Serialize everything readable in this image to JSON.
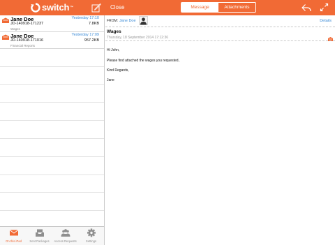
{
  "app": {
    "logo_text": "switch",
    "logo_tm": "™",
    "brand_color": "#f16a35",
    "link_color": "#3a8ad6"
  },
  "toolbar": {
    "compose_icon": "compose-icon",
    "close_label": "Close",
    "tabs": [
      {
        "label": "Message",
        "selected": true
      },
      {
        "label": "Attachments",
        "selected": false
      }
    ],
    "reply_icon": "reply-icon",
    "expand_icon": "expand-icon"
  },
  "packages": [
    {
      "name": "Jane Doe",
      "time": "Yesterday 17:10",
      "id": "JD-140918-171237",
      "size": "7.8KB",
      "subject": "Wages"
    },
    {
      "name": "Jane Doe",
      "time": "Yesterday 17:09",
      "id": "JD-140918-171016",
      "size": "957.2KB",
      "subject": "Financial Reports"
    }
  ],
  "message": {
    "from_label": "FROM:",
    "from_name": "Jane Doe",
    "details_label": "Details",
    "subject": "Wages",
    "date": "Thursday, 18 September 2014 17:12:36",
    "body": [
      "Hi John,",
      "Please find attached the wages you requested,",
      "Kind Regards,",
      "Jane"
    ]
  },
  "tabbar": [
    {
      "label": "On this iPad",
      "icon": "envelope-icon",
      "active": true
    },
    {
      "label": "Sent Packages",
      "icon": "inbox-tray-icon",
      "active": false
    },
    {
      "label": "Access Requests",
      "icon": "users-icon",
      "active": false
    },
    {
      "label": "Settings",
      "icon": "gear-icon",
      "active": false
    }
  ]
}
